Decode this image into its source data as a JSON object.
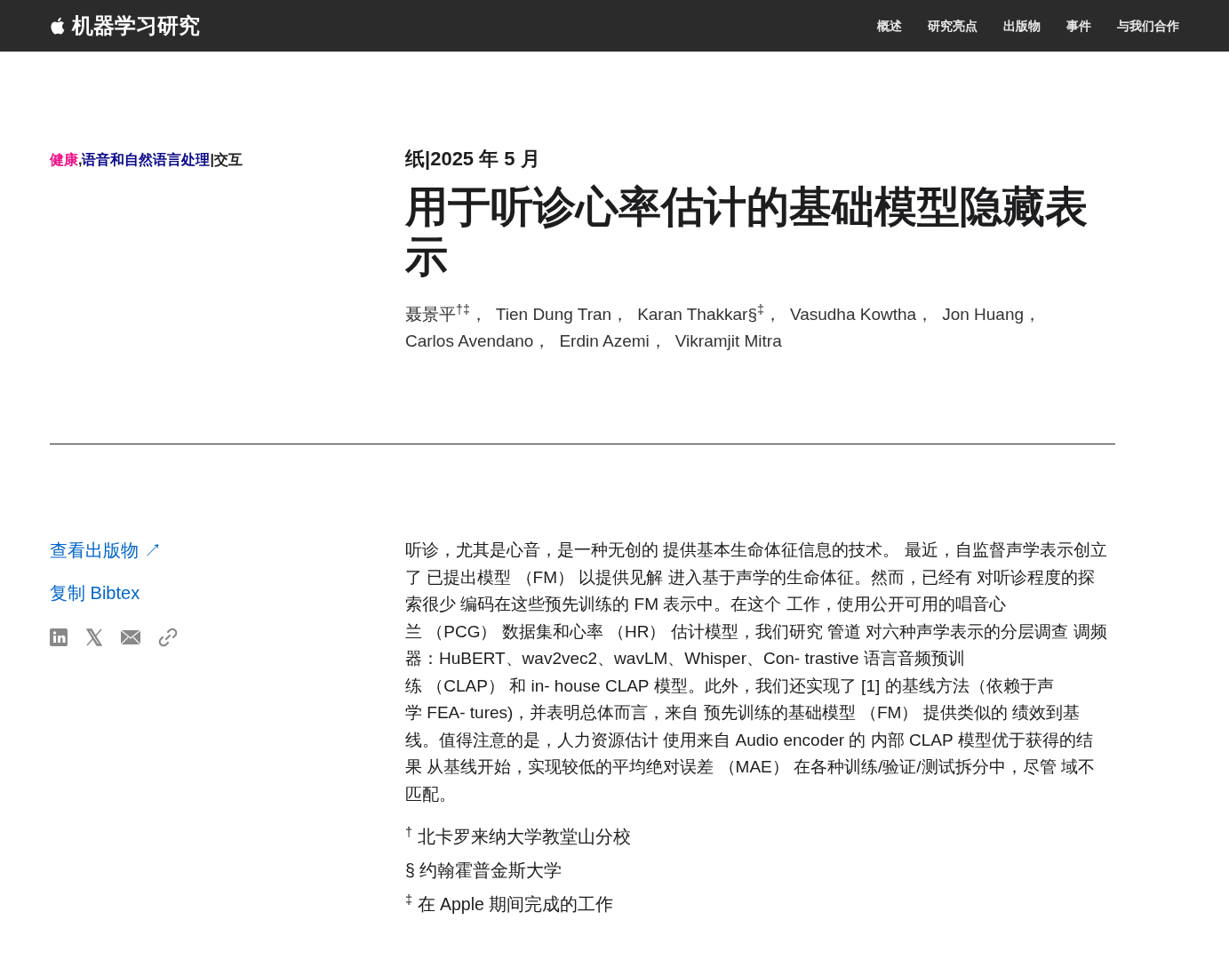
{
  "header": {
    "brand": "机器学习研究",
    "nav": [
      "概述",
      "研究亮点",
      "出版物",
      "事件",
      "与我们合作"
    ]
  },
  "topics": [
    {
      "text": "健康",
      "color": "#ee1188"
    },
    {
      "text": ",",
      "color": "#1d1d1f"
    },
    {
      "text": "语音和自然语言处理",
      "color": "#0a0a8a"
    },
    {
      "text": "|交互",
      "color": "#1d1d1f"
    }
  ],
  "meta": "纸|2025 年 5 月",
  "title": "用于听诊心率估计的基础模型隐藏表示",
  "authors": [
    "聂景平$^{†‡}$，",
    "Tien Dung Tran，",
    "Karan Thakkar§$^{‡}$，",
    "Vasudha Kowtha，",
    "Jon Huang，",
    "Carlos Avendano，",
    "Erdin Azemi，",
    "Vikramjit Mitra"
  ],
  "links": {
    "view": "查看出版物 ↗",
    "bibtex": "复制 Bibtex"
  },
  "abstract": "听诊，尤其是心音，是一种无创的 提供基本生命体征信息的技术。 最近，自监督声学表示创立了 已提出模型 （FM） 以提供见解 进入基于声学的生命体征。然而，已经有 对听诊程度的探索很少 编码在这些预先训练的 FM 表示中。在这个 工作，使用公开可用的唱音心兰 （PCG） 数据集和心率 （HR） 估计模型，我们研究 管道 对六种声学表示的分层调查 调频器：HuBERT、wav2vec2、wavLM、Whisper、Con- trastive 语言音频预训练 （CLAP） 和 in- house CLAP 模型。此外，我们还实现了 [1] 的基线方法（依赖于声学 FEA- tures)，并表明总体而言，来自 预先训练的基础模型 （FM） 提供类似的 绩效到基线。值得注意的是，人力资源估计 使用来自 Audio encoder 的 内部 CLAP 模型优于获得的结果 从基线开始，实现较低的平均绝对误差 （MAE） 在各种训练/验证/测试拆分中，尽管 域不匹配。",
  "footnotes": [
    "$^{†}$ 北卡罗来纳大学教堂山分校",
    "§ 约翰霍普金斯大学",
    "$^{‡}$ 在 Apple 期间完成的工作"
  ]
}
